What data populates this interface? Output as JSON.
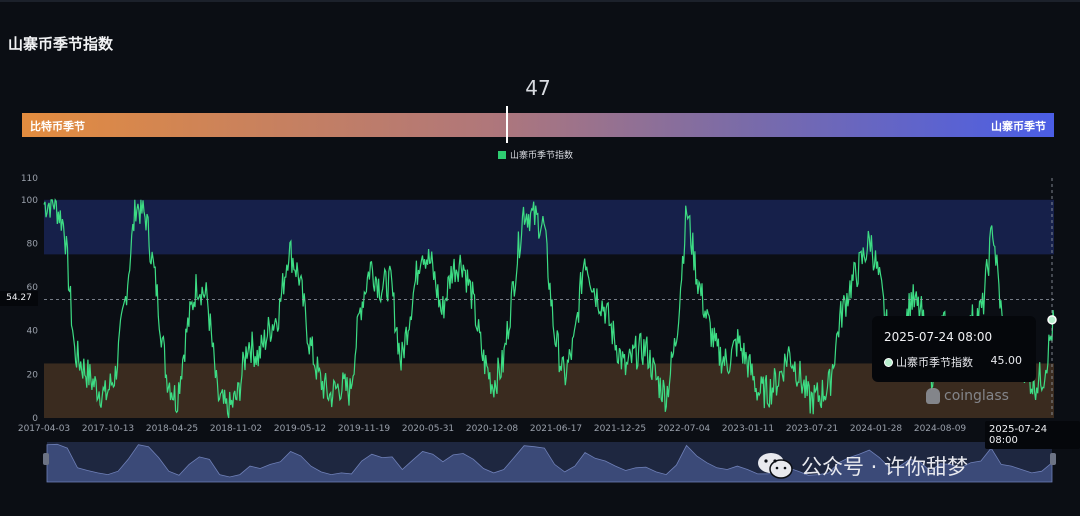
{
  "title": "山寨币季节指数",
  "gauge": {
    "value": "47",
    "value_num": 47,
    "left_label": "比特币季节",
    "right_label": "山寨币季节"
  },
  "legend": {
    "series_name": "山寨币季节指数",
    "color": "#2ecc71"
  },
  "tooltip": {
    "date": "2025-07-24 08:00",
    "series_name": "山寨币季节指数",
    "value": "45.00"
  },
  "crosshair": {
    "x_label": "2025-07-24 08:00",
    "y_label": "54.27"
  },
  "brand": "coinglass",
  "watermark": "公众号 · 许你甜梦",
  "colors": {
    "line": "#3ddc84",
    "upper_band": "#16204a",
    "lower_band": "#3a2b1f",
    "background": "#0b0e14"
  },
  "chart_data": {
    "type": "line",
    "title": "山寨币季节指数",
    "ylim": [
      0,
      110
    ],
    "yticks": [
      0,
      20,
      40,
      60,
      80,
      100
    ],
    "ytick_labels": [
      "0",
      "20",
      "40",
      "60",
      "80",
      "100",
      "110"
    ],
    "x_tick_labels": [
      "2017-04-03",
      "2017-10-13",
      "2018-04-25",
      "2018-11-02",
      "2019-05-12",
      "2019-11-19",
      "2020-05-31",
      "2020-12-08",
      "2021-06-17",
      "2021-12-25",
      "2022-07-04",
      "2023-01-11",
      "2023-07-21",
      "2024-01-28",
      "2024-08-09",
      "2025-07-24"
    ],
    "bands": [
      {
        "from": 75,
        "to": 100,
        "label": "山寨币季节"
      },
      {
        "from": 0,
        "to": 25,
        "label": "比特币季节"
      }
    ],
    "series": [
      {
        "name": "山寨币季节指数",
        "x": [
          "2017-04",
          "2017-05",
          "2017-06",
          "2017-07",
          "2017-08",
          "2017-09",
          "2017-10",
          "2017-11",
          "2017-12",
          "2018-01",
          "2018-02",
          "2018-03",
          "2018-04",
          "2018-05",
          "2018-06",
          "2018-07",
          "2018-08",
          "2018-09",
          "2018-10",
          "2018-11",
          "2018-12",
          "2019-01",
          "2019-02",
          "2019-03",
          "2019-04",
          "2019-05",
          "2019-06",
          "2019-07",
          "2019-08",
          "2019-09",
          "2019-10",
          "2019-11",
          "2019-12",
          "2020-01",
          "2020-02",
          "2020-03",
          "2020-04",
          "2020-05",
          "2020-06",
          "2020-07",
          "2020-08",
          "2020-09",
          "2020-10",
          "2020-11",
          "2020-12",
          "2021-01",
          "2021-02",
          "2021-03",
          "2021-04",
          "2021-05",
          "2021-06",
          "2021-07",
          "2021-08",
          "2021-09",
          "2021-10",
          "2021-11",
          "2021-12",
          "2022-01",
          "2022-02",
          "2022-03",
          "2022-04",
          "2022-05",
          "2022-06",
          "2022-07",
          "2022-08",
          "2022-09",
          "2022-10",
          "2022-11",
          "2022-12",
          "2023-01",
          "2023-02",
          "2023-03",
          "2023-04",
          "2023-05",
          "2023-06",
          "2023-07",
          "2023-08",
          "2023-09",
          "2023-10",
          "2023-11",
          "2023-12",
          "2024-01",
          "2024-02",
          "2024-03",
          "2024-04",
          "2024-05",
          "2024-06",
          "2024-07",
          "2024-08",
          "2024-09",
          "2024-10",
          "2024-11",
          "2024-12",
          "2025-01",
          "2025-02",
          "2025-03",
          "2025-04",
          "2025-05",
          "2025-06",
          "2025-07"
        ],
        "values": [
          98,
          99,
          88,
          30,
          22,
          15,
          10,
          20,
          55,
          98,
          92,
          60,
          20,
          8,
          40,
          62,
          55,
          10,
          3,
          10,
          35,
          28,
          40,
          48,
          78,
          65,
          35,
          18,
          10,
          15,
          12,
          50,
          70,
          60,
          62,
          25,
          52,
          78,
          70,
          48,
          68,
          72,
          55,
          28,
          15,
          25,
          60,
          95,
          92,
          88,
          40,
          18,
          35,
          75,
          58,
          50,
          35,
          22,
          30,
          32,
          18,
          10,
          38,
          96,
          65,
          45,
          30,
          25,
          35,
          25,
          12,
          12,
          18,
          30,
          20,
          8,
          10,
          15,
          45,
          60,
          70,
          82,
          60,
          30,
          35,
          55,
          48,
          20,
          42,
          40,
          30,
          45,
          50,
          88,
          40,
          35,
          25,
          15,
          20,
          45
        ]
      }
    ]
  }
}
